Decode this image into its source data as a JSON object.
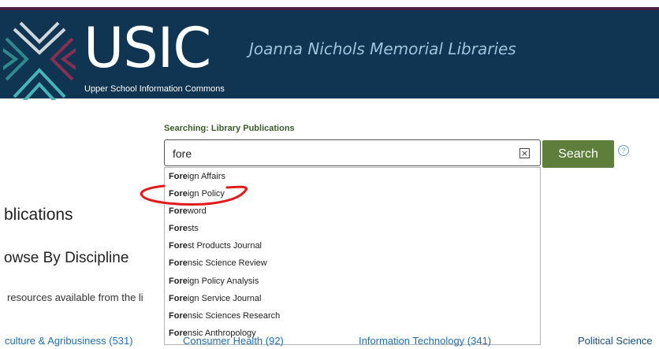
{
  "header": {
    "title": "USIC",
    "subtitle": "Upper School Information Commons",
    "library_name": "Joanna Nichols Memorial Libraries",
    "logo_icon": "usic-logo-icon"
  },
  "search": {
    "scope_label": "Searching: Library Publications",
    "query": "fore",
    "clear_label": "×",
    "button_label": "Search",
    "help_label": "?"
  },
  "suggestions": [
    {
      "match": "Fore",
      "rest": "ign Affairs"
    },
    {
      "match": "Fore",
      "rest": "ign Policy"
    },
    {
      "match": "Fore",
      "rest": "word"
    },
    {
      "match": "Fore",
      "rest": "sts"
    },
    {
      "match": "Fore",
      "rest": "st Products Journal"
    },
    {
      "match": "Fore",
      "rest": "nsic Science Review"
    },
    {
      "match": "Fore",
      "rest": "ign Policy Analysis"
    },
    {
      "match": "Fore",
      "rest": "ign Service Journal"
    },
    {
      "match": "Fore",
      "rest": "nsic Sciences Research"
    },
    {
      "match": "Fore",
      "rest": "nsic Anthropology"
    }
  ],
  "page": {
    "heading": "blications",
    "browse_heading": "owse By Discipline",
    "resources_text": "resources available from the li"
  },
  "disciplines": [
    {
      "label": "culture & Agribusiness (531)"
    },
    {
      "label": "Consumer Health (92)"
    },
    {
      "label": "Information Technology (341)"
    },
    {
      "label": "Political Science"
    }
  ],
  "colors": {
    "banner": "#0f3552",
    "banner_top": "#4a2143",
    "search_button": "#5e7f3b",
    "link": "#1f6fb2",
    "annotation": "#e01b1b"
  }
}
